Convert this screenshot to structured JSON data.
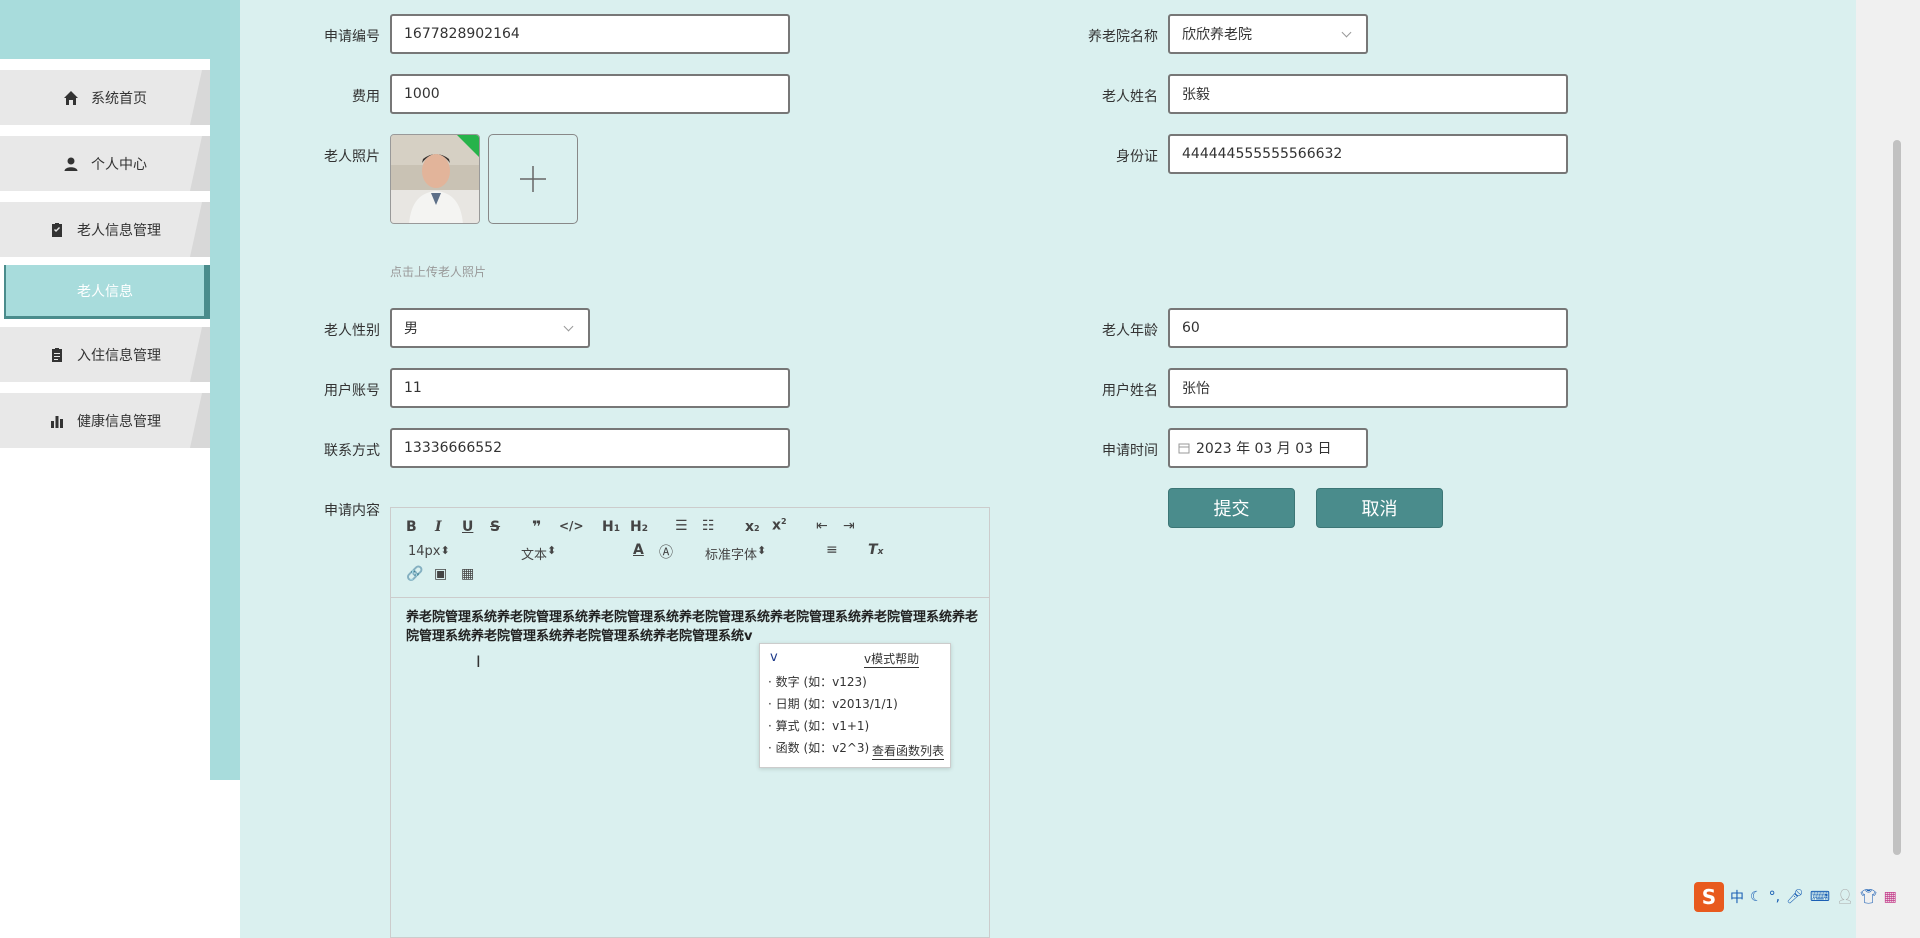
{
  "sidebar": {
    "items": [
      {
        "label": "系统首页",
        "icon": "home-icon"
      },
      {
        "label": "个人中心",
        "icon": "user-icon"
      },
      {
        "label": "老人信息管理",
        "icon": "clipboard-check-icon"
      },
      {
        "label": "老人信息",
        "icon": ""
      },
      {
        "label": "入住信息管理",
        "icon": "clipboard-icon"
      },
      {
        "label": "健康信息管理",
        "icon": "bar-chart-icon"
      }
    ]
  },
  "form": {
    "application_no_label": "申请编号",
    "application_no": "1677828902164",
    "nursing_home_label": "养老院名称",
    "nursing_home": "欣欣养老院",
    "fee_label": "费用",
    "fee": "1000",
    "elder_name_label": "老人姓名",
    "elder_name": "张毅",
    "photo_label": "老人照片",
    "id_card_label": "身份证",
    "id_card": "444444555555566632",
    "upload_hint": "点击上传老人照片",
    "gender_label": "老人性别",
    "gender": "男",
    "age_label": "老人年龄",
    "age": "60",
    "account_label": "用户账号",
    "account": "11",
    "user_name_label": "用户姓名",
    "user_name": "张怡",
    "contact_label": "联系方式",
    "contact": "13336666552",
    "apply_time_label": "申请时间",
    "apply_time": "2023 年 03 月 03 日",
    "content_label": "申请内容",
    "submit_label": "提交",
    "cancel_label": "取消"
  },
  "editor": {
    "font_size": "14px",
    "paragraph": "文本",
    "font_family": "标准字体",
    "content": "养老院管理系统养老院管理系统养老院管理系统养老院管理系统养老院管理系统养老院管理系统养老院管理系统养老院管理系统养老院管理系统养老院管理系统v"
  },
  "ime_popup": {
    "input": "v",
    "help": "v模式帮助",
    "rows": [
      "· 数字 (如：v123)",
      "· 日期 (如：v2013/1/1)",
      "· 算式 (如：v1+1)",
      "· 函数 (如：v2^3)"
    ],
    "link": "查看函数列表"
  },
  "ime_bar": {
    "logo": "S",
    "mode": "中"
  },
  "colors": {
    "main_bg": "#daf0ef",
    "sidebar_teal": "#a8dcdc",
    "button": "#4a8c8c"
  }
}
